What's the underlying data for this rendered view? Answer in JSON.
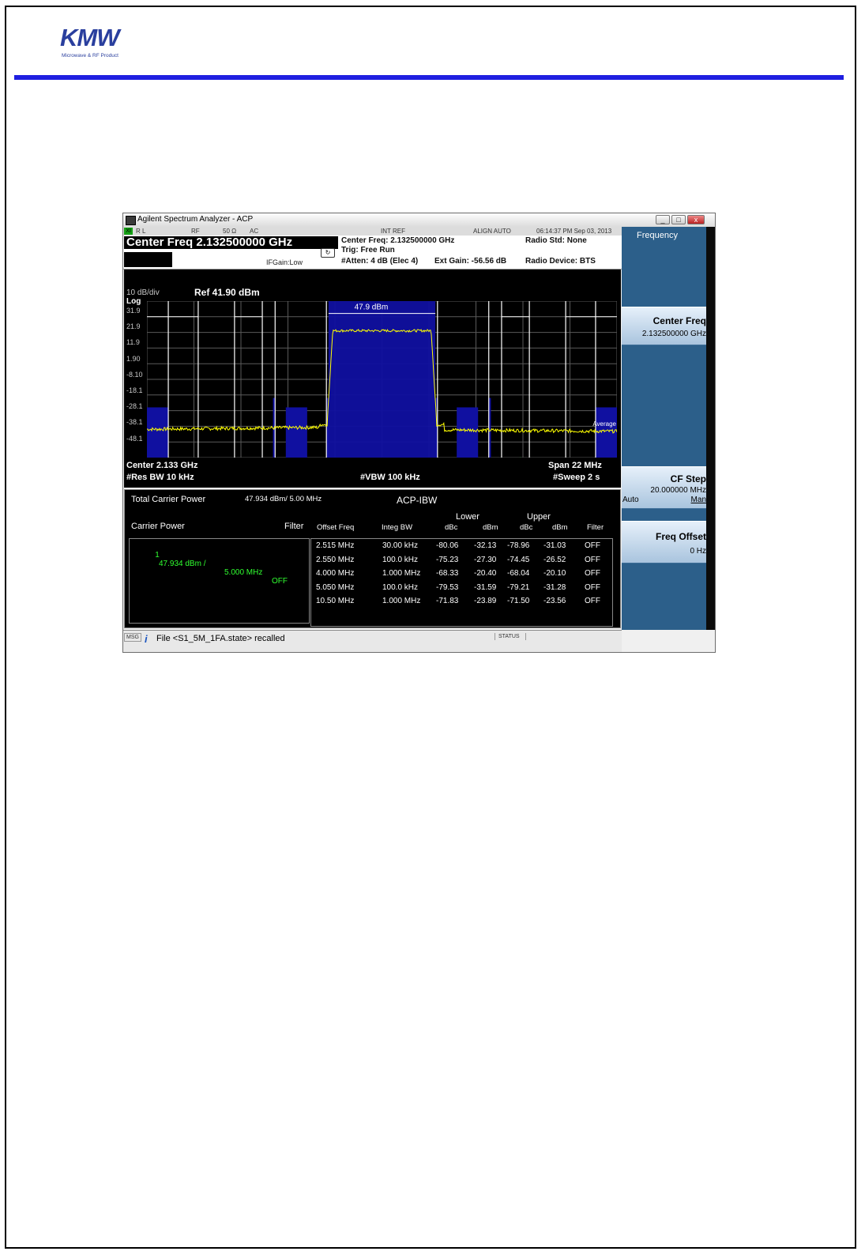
{
  "logo": {
    "text": "KMW",
    "subtitle": "Microwave & RF Product"
  },
  "window": {
    "title": "Agilent Spectrum Analyzer - ACP",
    "controls": [
      "_",
      "□",
      "x"
    ]
  },
  "status_row": {
    "rl": "R L",
    "rf": "RF",
    "impedance": "50 Ω",
    "coupling": "AC",
    "ref": "INT REF",
    "align": "ALIGN AUTO",
    "datetime": "06:14:37 PM Sep 03, 2013"
  },
  "header": {
    "center_freq_big": "Center Freq 2.132500000 GHz",
    "ifgain": "IFGain:Low",
    "center_freq": "Center Freq: 2.132500000 GHz",
    "trig": "Trig: Free Run",
    "atten": "#Atten: 4 dB (Elec 4)",
    "ext_gain": "Ext Gain: -56.56 dB",
    "radio_std": "Radio Std: None",
    "radio_device": "Radio Device: BTS"
  },
  "plot": {
    "scale": "10 dB/div",
    "log": "Log",
    "ref_level": "Ref 41.90 dBm",
    "y_ticks": [
      "31.9",
      "21.9",
      "11.9",
      "1.90",
      "-8.10",
      "-18.1",
      "-28.1",
      "-38.1",
      "-48.1"
    ],
    "carrier_label": "47.9 dBm",
    "average_label": "Average",
    "center": "Center  2.133 GHz",
    "span": "Span 22 MHz",
    "res_bw": "#Res BW  10 kHz",
    "vbw": "#VBW  100 kHz",
    "sweep": "#Sweep  2 s"
  },
  "chart_data": {
    "type": "line",
    "ylim": [
      -58.1,
      41.9
    ],
    "xlim_mhz": [
      -11,
      11
    ],
    "carrier_power_dbm": 47.9,
    "noise_floor_dbm": -40,
    "carrier_band_mhz": [
      -2.5,
      2.5
    ]
  },
  "measurement": {
    "total_carrier_power_label": "Total Carrier Power",
    "total_carrier_power_value": "47.934 dBm/ 5.00 MHz",
    "mode": "ACP-IBW",
    "carrier_power_label": "Carrier Power",
    "filter_label": "Filter",
    "carrier_row": {
      "index": "1",
      "power": "47.934 dBm /",
      "bw": "5.000 MHz",
      "filter": "OFF"
    },
    "headers": {
      "lower": "Lower",
      "upper": "Upper",
      "offset_freq": "Offset Freq",
      "integ_bw": "Integ BW",
      "dbc": "dBc",
      "dbm": "dBm",
      "filter": "Filter"
    },
    "rows": [
      {
        "offset": "2.515 MHz",
        "bw": "30.00 kHz",
        "l_dbc": "-80.06",
        "l_dbm": "-32.13",
        "u_dbc": "-78.96",
        "u_dbm": "-31.03",
        "filter": "OFF"
      },
      {
        "offset": "2.550 MHz",
        "bw": "100.0 kHz",
        "l_dbc": "-75.23",
        "l_dbm": "-27.30",
        "u_dbc": "-74.45",
        "u_dbm": "-26.52",
        "filter": "OFF"
      },
      {
        "offset": "4.000 MHz",
        "bw": "1.000 MHz",
        "l_dbc": "-68.33",
        "l_dbm": "-20.40",
        "u_dbc": "-68.04",
        "u_dbm": "-20.10",
        "filter": "OFF"
      },
      {
        "offset": "5.050 MHz",
        "bw": "100.0 kHz",
        "l_dbc": "-79.53",
        "l_dbm": "-31.59",
        "u_dbc": "-79.21",
        "u_dbm": "-31.28",
        "filter": "OFF"
      },
      {
        "offset": "10.50 MHz",
        "bw": "1.000 MHz",
        "l_dbc": "-71.83",
        "l_dbm": "-23.89",
        "u_dbc": "-71.50",
        "u_dbm": "-23.56",
        "filter": "OFF"
      }
    ]
  },
  "msgbar": {
    "msg": "MSG",
    "file": "File <S1_5M_1FA.state> recalled",
    "status": "STATUS"
  },
  "softkeys": {
    "title": "Frequency",
    "center_freq_label": "Center Freq",
    "center_freq_value": "2.132500000 GHz",
    "cf_step_label": "CF Step",
    "cf_step_value": "20.000000 MHz",
    "cf_step_auto": "Auto",
    "cf_step_man": "Man",
    "freq_offset_label": "Freq Offset",
    "freq_offset_value": "0 Hz"
  },
  "colors": {
    "trace": "#ffff00",
    "channel_fill": "#1010a0",
    "brand_blue": "#1f1fe0"
  }
}
